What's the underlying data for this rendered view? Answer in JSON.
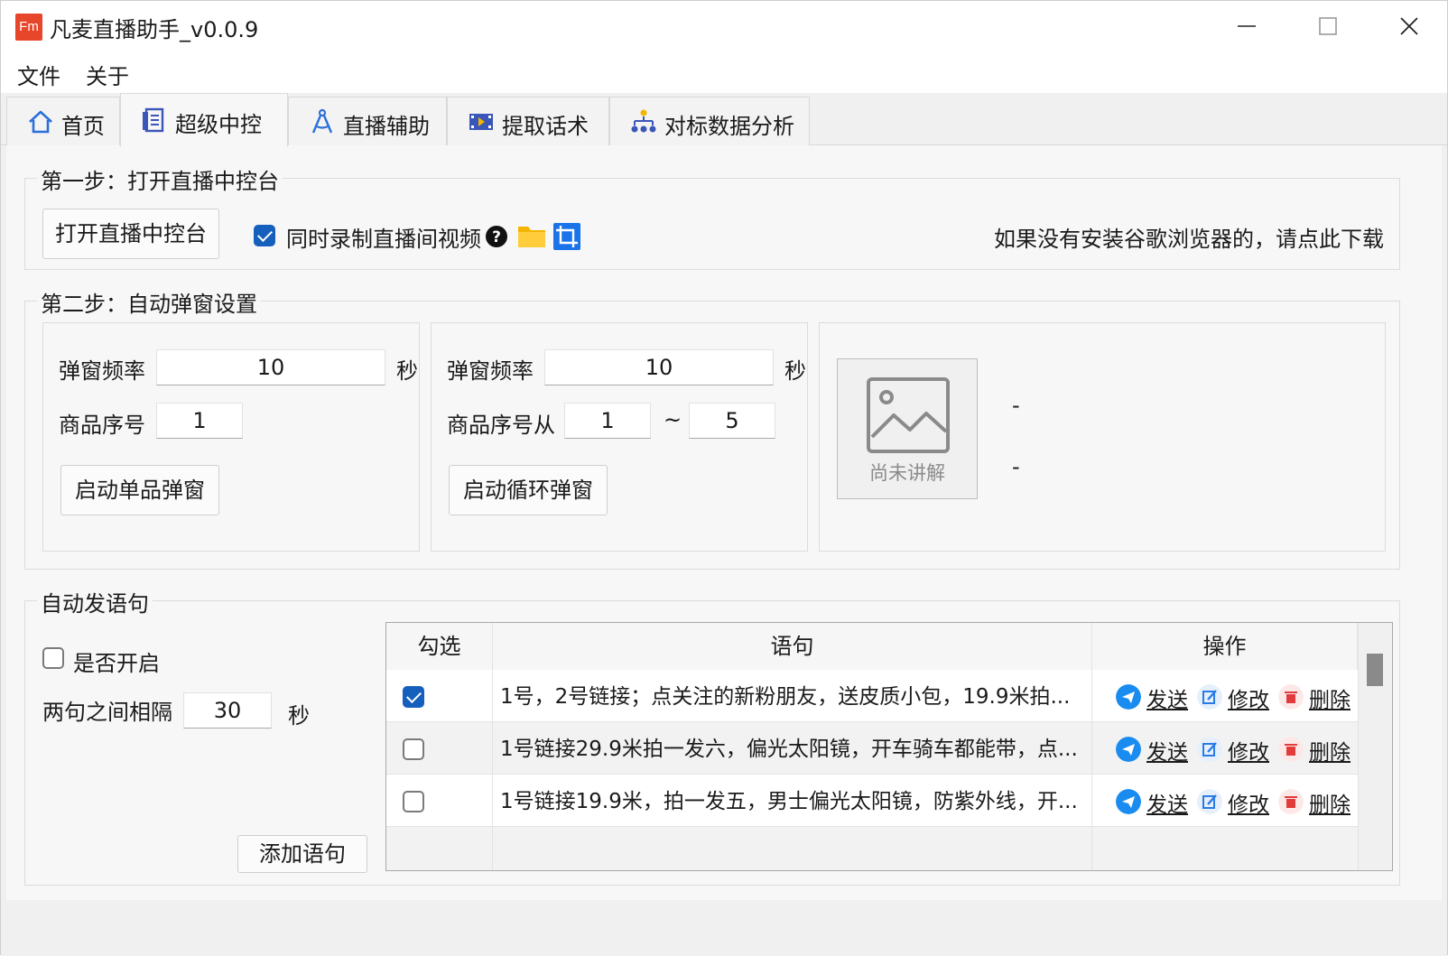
{
  "window": {
    "logo_text": "Fm",
    "title": "凡麦直播助手_v0.0.9"
  },
  "menu": [
    "文件",
    "关于"
  ],
  "tabs": [
    {
      "label": "首页",
      "icon": "home-icon"
    },
    {
      "label": "超级中控",
      "icon": "list-doc-icon",
      "active": true
    },
    {
      "label": "直播辅助",
      "icon": "compass-icon"
    },
    {
      "label": "提取话术",
      "icon": "film-icon"
    },
    {
      "label": "对标数据分析",
      "icon": "org-chart-icon"
    }
  ],
  "step1": {
    "title": "第一步：打开直播中控台",
    "open_button": "打开直播中控台",
    "record_checked": true,
    "record_label": "同时录制直播间视频",
    "download_hint": "如果没有安装谷歌浏览器的，请点此下载"
  },
  "step2": {
    "title": "第二步：自动弹窗设置",
    "single": {
      "freq_label": "弹窗频率",
      "freq_value": "10",
      "unit": "秒",
      "index_label": "商品序号",
      "index_value": "1",
      "start_button": "启动单品弹窗"
    },
    "loop": {
      "freq_label": "弹窗频率",
      "freq_value": "10",
      "unit": "秒",
      "range_label": "商品序号从",
      "from_value": "1",
      "tilde": "~",
      "to_value": "5",
      "start_button": "启动循环弹窗"
    },
    "preview": {
      "caption": "尚未讲解",
      "line1": "-",
      "line2": "-"
    }
  },
  "auto_send": {
    "title": "自动发语句",
    "enable_label": "是否开启",
    "enabled": false,
    "interval_label": "两句之间相隔",
    "interval_value": "30",
    "unit": "秒",
    "add_button": "添加语句",
    "table": {
      "headers": [
        "勾选",
        "语句",
        "操作"
      ],
      "rows": [
        {
          "checked": true,
          "sentence": "1号，2号链接；点关注的新粉朋友，送皮质小包，19.9米拍..."
        },
        {
          "checked": false,
          "sentence": "1号链接29.9米拍一发六，偏光太阳镜，开车骑车都能带，点..."
        },
        {
          "checked": false,
          "sentence": "1号链接19.9米，拍一发五，男士偏光太阳镜，防紫外线，开..."
        }
      ],
      "actions": {
        "send": "发送",
        "edit": "修改",
        "delete": "删除"
      }
    }
  },
  "colors": {
    "accent": "#1560bd",
    "logo": "#e8462a",
    "folder": "#f5b400",
    "delete": "#e23b3b"
  }
}
